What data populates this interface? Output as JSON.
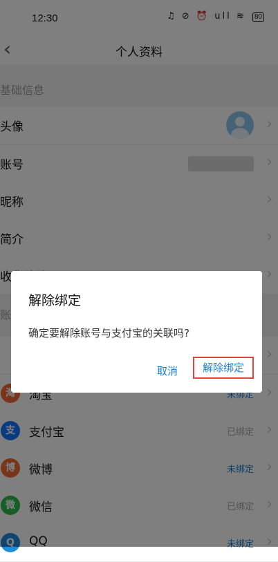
{
  "status_bar": {
    "time": "12:30",
    "icons": "♫ ⊘ ⏰ ull ≋",
    "battery": "80"
  },
  "nav": {
    "back_icon": "‹",
    "title": "个人资料"
  },
  "sections": {
    "basic": "基础信息",
    "account": "账"
  },
  "rows": {
    "avatar": "头像",
    "account": "账号",
    "nickname": "昵称",
    "intro": "简介",
    "address_partial": "收货地址"
  },
  "bindings": [
    {
      "name": "淘宝",
      "status": "未绑定",
      "icon": "淘",
      "color": "#f06a35"
    },
    {
      "name": "支付宝",
      "status": "已绑定",
      "icon": "支",
      "color": "#1677ff"
    },
    {
      "name": "微博",
      "status": "未绑定",
      "icon": "博",
      "color": "#f06a35"
    },
    {
      "name": "微信",
      "status": "已绑定",
      "icon": "微",
      "color": "#2fbb4f"
    },
    {
      "name": "QQ",
      "status": "未绑定",
      "icon": "Q",
      "color": "#1e8ddd"
    }
  ],
  "dialog": {
    "title": "解除绑定",
    "message": "确定要解除账号与支付宝的关联吗?",
    "cancel": "取消",
    "confirm": "解除绑定"
  }
}
